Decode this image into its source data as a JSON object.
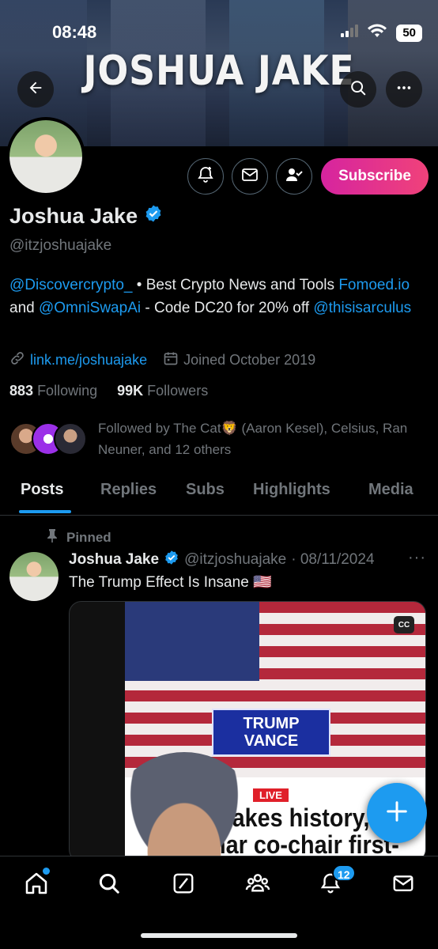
{
  "status_bar": {
    "time": "08:48",
    "battery": "50"
  },
  "profile": {
    "banner_title": "JOSHUA JAKE",
    "name": "Joshua Jake",
    "handle": "@itzjoshuajake",
    "subscribe_label": "Subscribe",
    "bio": {
      "mention1": "@Discovercrypto_",
      "text1": " • Best Crypto News and Tools ",
      "link1": "Fomoed.io",
      "text2": " and ",
      "mention2": "@OmniSwapAi",
      "text3": " - Code DC20 for 20% off ",
      "mention3": "@thisisarculus"
    },
    "website": "link.me/joshuajake",
    "joined": "Joined October 2019",
    "following_count": "883",
    "following_label": "Following",
    "followers_count": "99K",
    "followers_label": "Followers",
    "followed_by": "Followed by The Cat🦁 (Aaron Kesel), Celsius, Ran Neuner, and 12 others"
  },
  "tabs": [
    "Posts",
    "Replies",
    "Subs",
    "Highlights",
    "Media"
  ],
  "pinned_post": {
    "pinned_label": "Pinned",
    "author": "Joshua Jake",
    "handle": "@itzjoshuajake",
    "date": "· 08/11/2024",
    "text": "The Trump Effect Is Insane 🇺🇸",
    "media": {
      "podium_line1": "TRUMP",
      "podium_line2": "VANCE",
      "live_label": "LIVE",
      "headline": "makes history, nar co-chair first-ever",
      "cc_label": "CC"
    }
  },
  "bottom_nav": {
    "notifications_badge": "12"
  },
  "colors": {
    "accent": "#1d9bf0",
    "subscribe_start": "#d6249f",
    "subscribe_end": "#f0427a"
  }
}
